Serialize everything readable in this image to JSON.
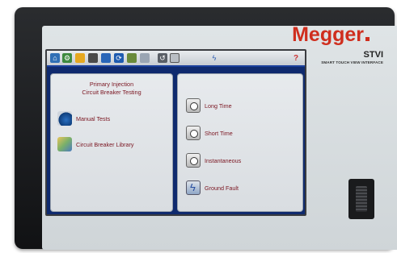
{
  "device": {
    "brand": "Megger",
    "model": "STVI",
    "model_subtitle": "SMART TOUCH VIEW INTERFACE"
  },
  "toolbar": {
    "icons": [
      "home-icon",
      "settings-icon",
      "folder-icon",
      "film-icon",
      "monitor-icon",
      "refresh-icon",
      "chart-icon",
      "document-icon",
      "undo-icon",
      "timer-icon",
      "fault-icon"
    ],
    "help_label": "?"
  },
  "left_panel": {
    "title_line1": "Primary Injection",
    "title_line2": "Circuit Breaker Testing",
    "items": [
      {
        "label": "Manual Tests",
        "icon": "manual-tests-icon"
      },
      {
        "label": "Circuit Breaker Library",
        "icon": "library-icon"
      }
    ]
  },
  "right_panel": {
    "items": [
      {
        "label": "Long Time",
        "icon": "clock-icon"
      },
      {
        "label": "Short Time",
        "icon": "clock-icon"
      },
      {
        "label": "Instantaneous",
        "icon": "clock-icon"
      },
      {
        "label": "Ground Fault",
        "icon": "ground-fault-icon"
      }
    ]
  },
  "colors": {
    "brand_red": "#cf2e1e",
    "screen_blue": "#0f2a6e",
    "label_maroon": "#7a1520"
  }
}
